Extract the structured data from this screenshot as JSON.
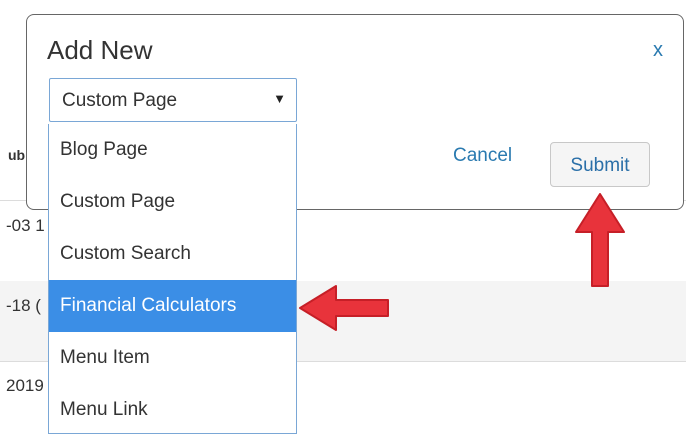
{
  "background": {
    "header_fragment": "ub",
    "row_fragments": [
      "-03 1",
      "-18 (",
      "2019"
    ]
  },
  "modal": {
    "title": "Add New",
    "close_label": "x",
    "select": {
      "value": "Custom Page"
    },
    "cancel_label": "Cancel",
    "submit_label": "Submit"
  },
  "dropdown": {
    "items": [
      {
        "label": "Blog Page"
      },
      {
        "label": "Custom Page"
      },
      {
        "label": "Custom Search"
      },
      {
        "label": "Financial Calculators"
      },
      {
        "label": "Menu Item"
      },
      {
        "label": "Menu Link"
      }
    ],
    "selected_index": 3
  },
  "colors": {
    "accent": "#3b8ee6",
    "link": "#2a7ab0",
    "arrow": "#e8333b"
  }
}
